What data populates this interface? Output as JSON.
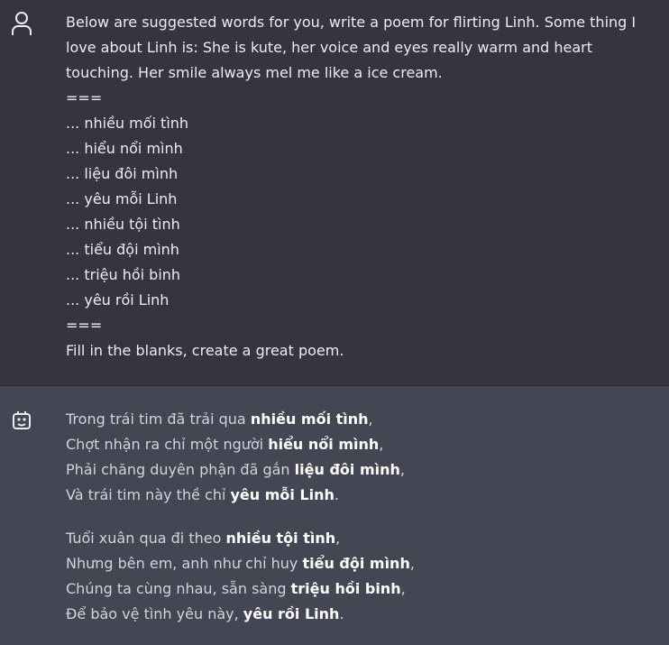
{
  "user_message": {
    "intro": "Below are suggested words for you, write a poem for flirting Linh. Some thing I love about Linh is: She is kute, her voice and eyes really warm and heart touching. Her smile always mel me like a ice cream.",
    "separator_top": "===",
    "suggested_words": [
      "... nhiều mối tình",
      "... hiểu nổi mình",
      "... liệu đôi mình",
      "... yêu mỗi Linh",
      "... nhiều tội tình",
      "... tiểu đội mình",
      "... triệu hồi binh",
      "... yêu rồi Linh"
    ],
    "separator_bottom": "===",
    "instruction": "Fill in the blanks, create a great poem."
  },
  "assistant_message": {
    "stanzas": [
      [
        {
          "pre": "Trong trái tim đã trải qua ",
          "bold": "nhiều mối tình",
          "post": ","
        },
        {
          "pre": "Chợt nhận ra chỉ một người ",
          "bold": "hiểu nổi mình",
          "post": ","
        },
        {
          "pre": "Phải chăng duyên phận đã gắn ",
          "bold": "liệu đôi mình",
          "post": ","
        },
        {
          "pre": "Và trái tim này thề chỉ ",
          "bold": "yêu mỗi Linh",
          "post": "."
        }
      ],
      [
        {
          "pre": "Tuổi xuân qua đi theo ",
          "bold": "nhiều tội tình",
          "post": ","
        },
        {
          "pre": "Nhưng bên em, anh như chỉ huy ",
          "bold": "tiểu đội mình",
          "post": ","
        },
        {
          "pre": "Chúng ta cùng nhau, sẵn sàng ",
          "bold": "triệu hồi binh",
          "post": ","
        },
        {
          "pre": "Để bảo vệ tình yêu này, ",
          "bold": "yêu rồi Linh",
          "post": "."
        }
      ]
    ]
  },
  "icons": {
    "user": "user-icon",
    "assistant": "bot-icon"
  },
  "colors": {
    "user_bg": "#343541",
    "assistant_bg": "#444654",
    "text": "#ececf1"
  }
}
